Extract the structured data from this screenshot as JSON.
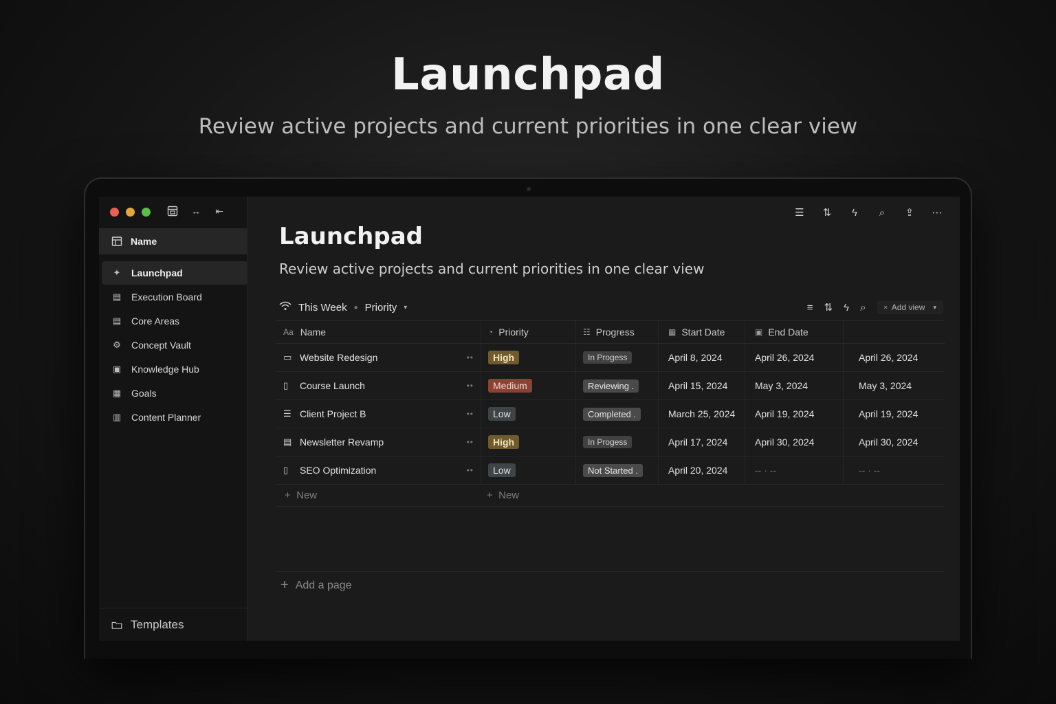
{
  "hero": {
    "title": "Launchpad",
    "subtitle": "Review active projects and current priorities in one clear view"
  },
  "sidebar": {
    "header": "Name",
    "items": [
      {
        "label": "Launchpad",
        "icon": "launch-icon",
        "active": true
      },
      {
        "label": "Execution Board",
        "icon": "board-icon"
      },
      {
        "label": "Core Areas",
        "icon": "areas-icon"
      },
      {
        "label": "Concept Vault",
        "icon": "gear-icon"
      },
      {
        "label": "Knowledge Hub",
        "icon": "book-icon"
      },
      {
        "label": "Goals",
        "icon": "goals-icon"
      },
      {
        "label": "Content Planner",
        "icon": "planner-icon"
      }
    ],
    "footer": "Templates"
  },
  "page": {
    "title": "Launchpad",
    "subtitle": "Review active projects and current priorities in one clear view"
  },
  "viewbar": {
    "view_name": "This Week",
    "group_by": "Priority",
    "add_view": "Add view"
  },
  "table": {
    "columns": {
      "name": "Name",
      "priority": "Priority",
      "progress": "Progress",
      "start": "Start Date",
      "end": "End Date",
      "name_prefix": "Aa"
    },
    "rows": [
      {
        "name": "Website Redesign",
        "priority": "High",
        "progress": "In Progess",
        "start": "April 8, 2024",
        "end": "April 26, 2024",
        "end2": "April 26, 2024"
      },
      {
        "name": "Course Launch",
        "priority": "Medium",
        "progress": "Reviewing .",
        "start": "April 15, 2024",
        "end": "May 3, 2024",
        "end2": "May 3, 2024"
      },
      {
        "name": "Client Project B",
        "priority": "Low",
        "progress": "Completed .",
        "start": "March 25, 2024",
        "end": "April 19, 2024",
        "end2": "April 19, 2024"
      },
      {
        "name": "Newsletter Revamp",
        "priority": "High",
        "progress": "In Progess",
        "start": "April 17, 2024",
        "end": "April 30, 2024",
        "end2": "April 30, 2024"
      },
      {
        "name": "SEO Optimization",
        "priority": "Low",
        "progress": "Not Started .",
        "start": "April 20, 2024",
        "end": "-- · --",
        "end2": "-- · --"
      }
    ],
    "new_label": "New"
  },
  "add_page": "Add a page",
  "colors": {
    "high": "#6e5b2f",
    "medium": "#8a4235",
    "low": "#3f4446"
  }
}
